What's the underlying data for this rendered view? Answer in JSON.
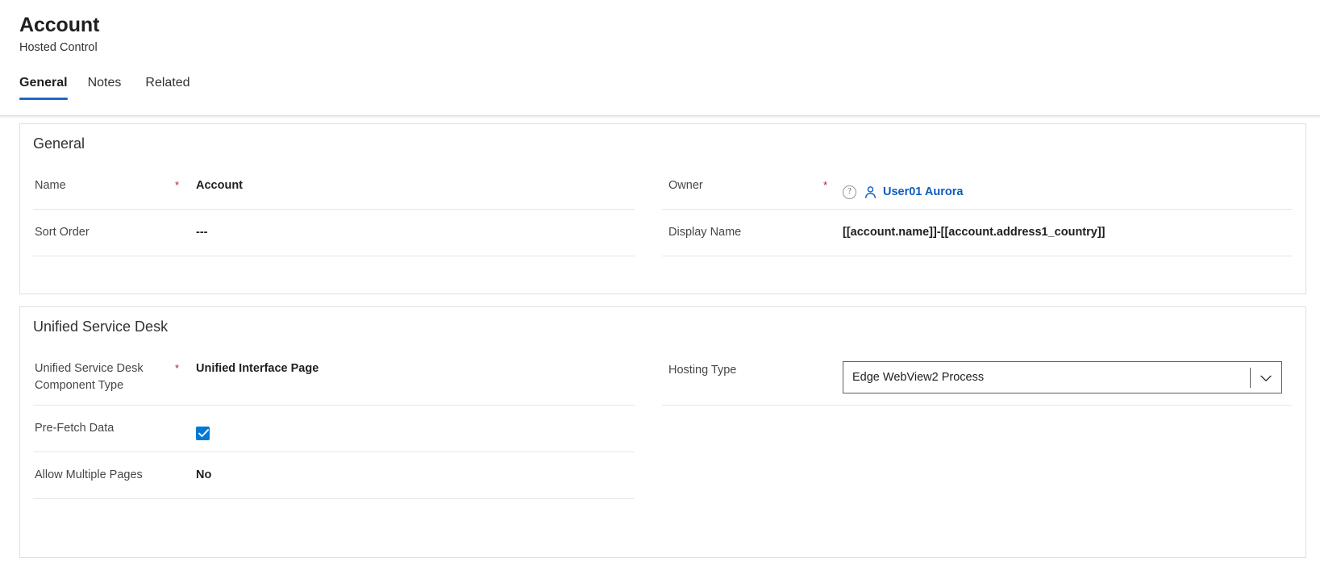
{
  "header": {
    "title": "Account",
    "subtitle": "Hosted Control",
    "tabs": [
      {
        "label": "General",
        "active": true
      },
      {
        "label": "Notes",
        "active": false
      },
      {
        "label": "Related",
        "active": false
      }
    ]
  },
  "colors": {
    "accent": "#2266cc",
    "link": "#0f5bbf",
    "required": "#a4262c",
    "checkbox": "#0078d4",
    "border": "#e1dfdd",
    "divider": "#e8e6e4"
  },
  "sections": [
    {
      "title": "General",
      "left_fields": [
        {
          "label": "Name",
          "required": "*",
          "value": "Account"
        },
        {
          "label": "Sort Order",
          "required": "",
          "value": "---"
        }
      ],
      "right_fields": [
        {
          "label": "Owner",
          "required": "*",
          "info_icon": "?",
          "person_icon": "person-icon",
          "value": "User01 Aurora",
          "type": "lookup"
        },
        {
          "label": "Display Name",
          "required": "",
          "value": "[[account.name]]-[[account.address1_country]]",
          "type": "text"
        }
      ]
    },
    {
      "title": "Unified Service Desk",
      "left_fields": [
        {
          "label": "Unified Service Desk Component Type",
          "required": "*",
          "value": "Unified Interface Page"
        },
        {
          "label": "Pre-Fetch Data",
          "required": "",
          "value": "",
          "type": "checkbox",
          "checked": true
        },
        {
          "label": "Allow Multiple Pages",
          "required": "",
          "value": "No"
        }
      ],
      "right_fields": [
        {
          "label": "Hosting Type",
          "required": "",
          "value": "Edge WebView2 Process",
          "type": "dropdown",
          "caret_icon": "chevron-down-icon"
        }
      ]
    }
  ]
}
